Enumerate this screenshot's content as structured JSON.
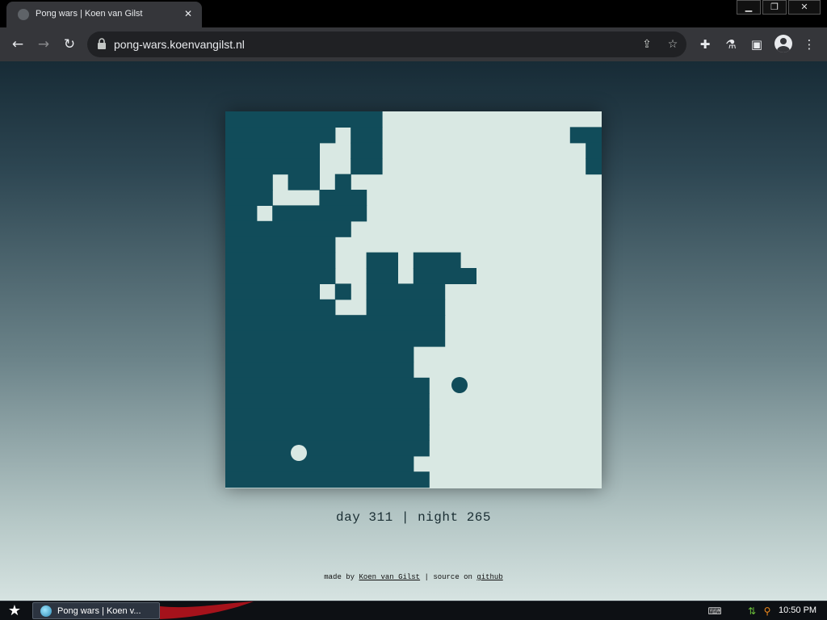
{
  "browser": {
    "tab_title": "Pong wars | Koen van Gilst",
    "url": "pong-wars.koenvangilst.nl"
  },
  "icons": {
    "favicon": "globe-icon",
    "close": "close-icon",
    "back": "arrow-left-icon",
    "forward": "arrow-right-icon",
    "reload": "reload-icon",
    "lock": "lock-icon",
    "share": "share-icon",
    "bookmark": "star-icon",
    "extensions": "puzzle-icon",
    "labs": "flask-icon",
    "sidepanel": "sidepanel-icon",
    "profile": "avatar-icon",
    "menu": "kebab-menu-icon"
  },
  "game": {
    "day_color": "#d9e8e3",
    "night_color": "#114c5a",
    "score_day_label": "day",
    "score_day": "311",
    "score_separator": "|",
    "score_night_label": "night",
    "score_night": "265"
  },
  "footer": {
    "made_by_label": "made by",
    "author": "Koen van Gilst",
    "separator": "|",
    "source_label": "source on",
    "source_link": "github"
  },
  "taskbar": {
    "task_label": "Pong wars | Koen v...",
    "clock": "10:50 PM"
  }
}
